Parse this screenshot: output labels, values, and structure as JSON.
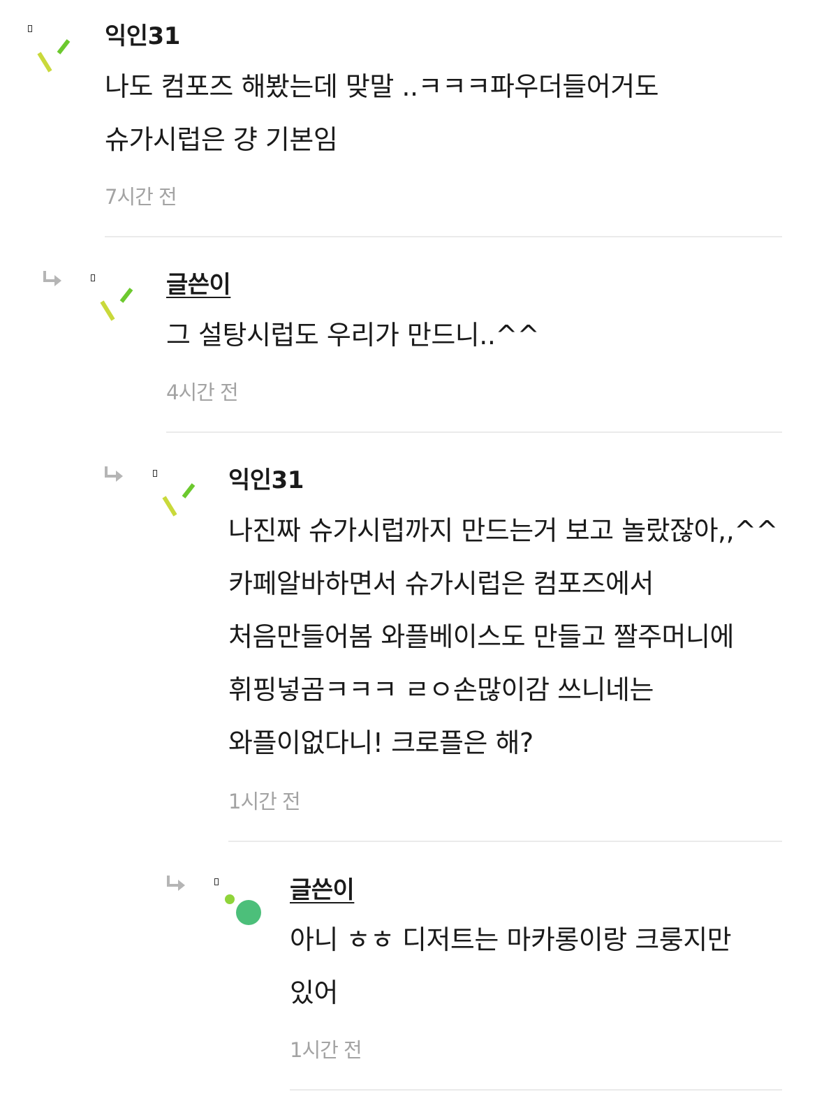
{
  "comments": [
    {
      "author": "익인31",
      "is_op": false,
      "text": "나도 컴포즈 해봤는데 맞말 ..ㅋㅋㅋ파우더들어거도 슈가시럽은 걍 기본임",
      "time": "7시간 전"
    },
    {
      "author": "글쓴이",
      "is_op": true,
      "text": "그 설탕시럽도 우리가 만드니..^^",
      "time": "4시간 전"
    },
    {
      "author": "익인31",
      "is_op": false,
      "text": "나진짜 슈가시럽까지 만드는거 보고 놀랐잖아,,^^카페알바하면서 슈가시럽은 컴포즈에서 처음만들어봄 와플베이스도 만들고 짤주머니에 휘핑넣곰ㅋㅋㅋ ㄹㅇ손많이감 쓰니네는 와플이없다니! 크로플은 해?",
      "time": "1시간 전"
    },
    {
      "author": "글쓴이",
      "is_op": true,
      "text": "아니 ㅎㅎ 디저트는 마카롱이랑 크룽지만 있어",
      "time": "1시간 전"
    }
  ],
  "colors": {
    "avatar_yellow": "#c9d93b",
    "avatar_green": "#6cc92e",
    "op_dot_small": "#8fd43a",
    "op_dot_big": "#4cbf7a",
    "divider": "#eaeaea",
    "timestamp": "#a3a3a3",
    "arrow": "#b5b5b5"
  },
  "icons": {
    "reply": "reply-arrow-icon",
    "avatar_anon": "anonymous-avatar-icon",
    "avatar_op": "op-avatar-icon"
  }
}
